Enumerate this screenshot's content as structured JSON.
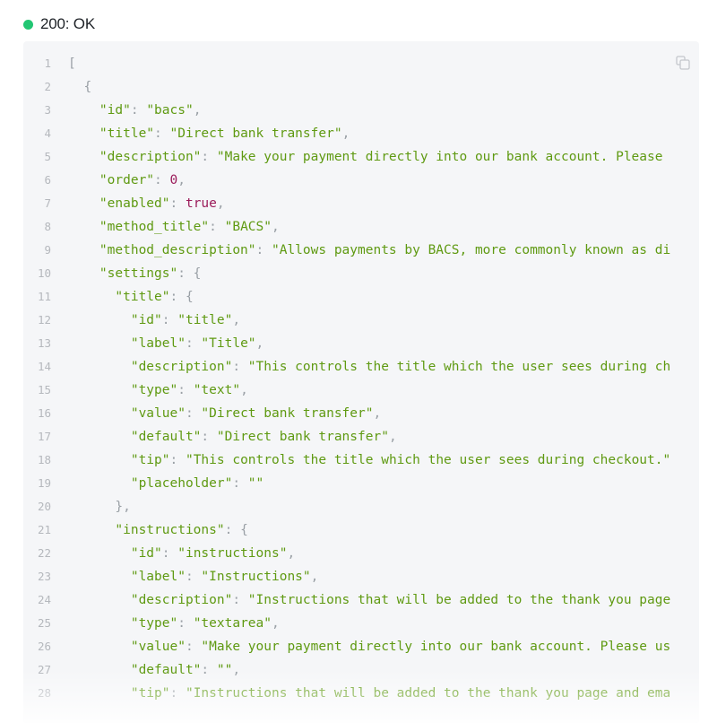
{
  "status": {
    "code_label": "200: OK",
    "color": "#22c673"
  },
  "code_block": {
    "copy_icon": "copy-icon",
    "lines": [
      [
        {
          "t": "pun",
          "v": "["
        }
      ],
      [
        {
          "t": "pun",
          "v": "  {"
        }
      ],
      [
        {
          "t": "str",
          "v": "    \"id\""
        },
        {
          "t": "pun",
          "v": ": "
        },
        {
          "t": "str",
          "v": "\"bacs\""
        },
        {
          "t": "pun",
          "v": ","
        }
      ],
      [
        {
          "t": "str",
          "v": "    \"title\""
        },
        {
          "t": "pun",
          "v": ": "
        },
        {
          "t": "str",
          "v": "\"Direct bank transfer\""
        },
        {
          "t": "pun",
          "v": ","
        }
      ],
      [
        {
          "t": "str",
          "v": "    \"description\""
        },
        {
          "t": "pun",
          "v": ": "
        },
        {
          "t": "str",
          "v": "\"Make your payment directly into our bank account. Please"
        }
      ],
      [
        {
          "t": "str",
          "v": "    \"order\""
        },
        {
          "t": "pun",
          "v": ": "
        },
        {
          "t": "lit",
          "v": "0"
        },
        {
          "t": "pun",
          "v": ","
        }
      ],
      [
        {
          "t": "str",
          "v": "    \"enabled\""
        },
        {
          "t": "pun",
          "v": ": "
        },
        {
          "t": "lit",
          "v": "true"
        },
        {
          "t": "pun",
          "v": ","
        }
      ],
      [
        {
          "t": "str",
          "v": "    \"method_title\""
        },
        {
          "t": "pun",
          "v": ": "
        },
        {
          "t": "str",
          "v": "\"BACS\""
        },
        {
          "t": "pun",
          "v": ","
        }
      ],
      [
        {
          "t": "str",
          "v": "    \"method_description\""
        },
        {
          "t": "pun",
          "v": ": "
        },
        {
          "t": "str",
          "v": "\"Allows payments by BACS, more commonly known as di"
        }
      ],
      [
        {
          "t": "str",
          "v": "    \"settings\""
        },
        {
          "t": "pun",
          "v": ": {"
        }
      ],
      [
        {
          "t": "str",
          "v": "      \"title\""
        },
        {
          "t": "pun",
          "v": ": {"
        }
      ],
      [
        {
          "t": "str",
          "v": "        \"id\""
        },
        {
          "t": "pun",
          "v": ": "
        },
        {
          "t": "str",
          "v": "\"title\""
        },
        {
          "t": "pun",
          "v": ","
        }
      ],
      [
        {
          "t": "str",
          "v": "        \"label\""
        },
        {
          "t": "pun",
          "v": ": "
        },
        {
          "t": "str",
          "v": "\"Title\""
        },
        {
          "t": "pun",
          "v": ","
        }
      ],
      [
        {
          "t": "str",
          "v": "        \"description\""
        },
        {
          "t": "pun",
          "v": ": "
        },
        {
          "t": "str",
          "v": "\"This controls the title which the user sees during ch"
        }
      ],
      [
        {
          "t": "str",
          "v": "        \"type\""
        },
        {
          "t": "pun",
          "v": ": "
        },
        {
          "t": "str",
          "v": "\"text\""
        },
        {
          "t": "pun",
          "v": ","
        }
      ],
      [
        {
          "t": "str",
          "v": "        \"value\""
        },
        {
          "t": "pun",
          "v": ": "
        },
        {
          "t": "str",
          "v": "\"Direct bank transfer\""
        },
        {
          "t": "pun",
          "v": ","
        }
      ],
      [
        {
          "t": "str",
          "v": "        \"default\""
        },
        {
          "t": "pun",
          "v": ": "
        },
        {
          "t": "str",
          "v": "\"Direct bank transfer\""
        },
        {
          "t": "pun",
          "v": ","
        }
      ],
      [
        {
          "t": "str",
          "v": "        \"tip\""
        },
        {
          "t": "pun",
          "v": ": "
        },
        {
          "t": "str",
          "v": "\"This controls the title which the user sees during checkout.\""
        }
      ],
      [
        {
          "t": "str",
          "v": "        \"placeholder\""
        },
        {
          "t": "pun",
          "v": ": "
        },
        {
          "t": "str",
          "v": "\"\""
        }
      ],
      [
        {
          "t": "pun",
          "v": "      },"
        }
      ],
      [
        {
          "t": "str",
          "v": "      \"instructions\""
        },
        {
          "t": "pun",
          "v": ": {"
        }
      ],
      [
        {
          "t": "str",
          "v": "        \"id\""
        },
        {
          "t": "pun",
          "v": ": "
        },
        {
          "t": "str",
          "v": "\"instructions\""
        },
        {
          "t": "pun",
          "v": ","
        }
      ],
      [
        {
          "t": "str",
          "v": "        \"label\""
        },
        {
          "t": "pun",
          "v": ": "
        },
        {
          "t": "str",
          "v": "\"Instructions\""
        },
        {
          "t": "pun",
          "v": ","
        }
      ],
      [
        {
          "t": "str",
          "v": "        \"description\""
        },
        {
          "t": "pun",
          "v": ": "
        },
        {
          "t": "str",
          "v": "\"Instructions that will be added to the thank you page"
        }
      ],
      [
        {
          "t": "str",
          "v": "        \"type\""
        },
        {
          "t": "pun",
          "v": ": "
        },
        {
          "t": "str",
          "v": "\"textarea\""
        },
        {
          "t": "pun",
          "v": ","
        }
      ],
      [
        {
          "t": "str",
          "v": "        \"value\""
        },
        {
          "t": "pun",
          "v": ": "
        },
        {
          "t": "str",
          "v": "\"Make your payment directly into our bank account. Please us"
        }
      ],
      [
        {
          "t": "str",
          "v": "        \"default\""
        },
        {
          "t": "pun",
          "v": ": "
        },
        {
          "t": "str",
          "v": "\"\""
        },
        {
          "t": "pun",
          "v": ","
        }
      ],
      [
        {
          "t": "str",
          "v": "        \"tip\""
        },
        {
          "t": "pun",
          "v": ": "
        },
        {
          "t": "str",
          "v": "\"Instructions that will be added to the thank you page and ema"
        }
      ]
    ]
  }
}
